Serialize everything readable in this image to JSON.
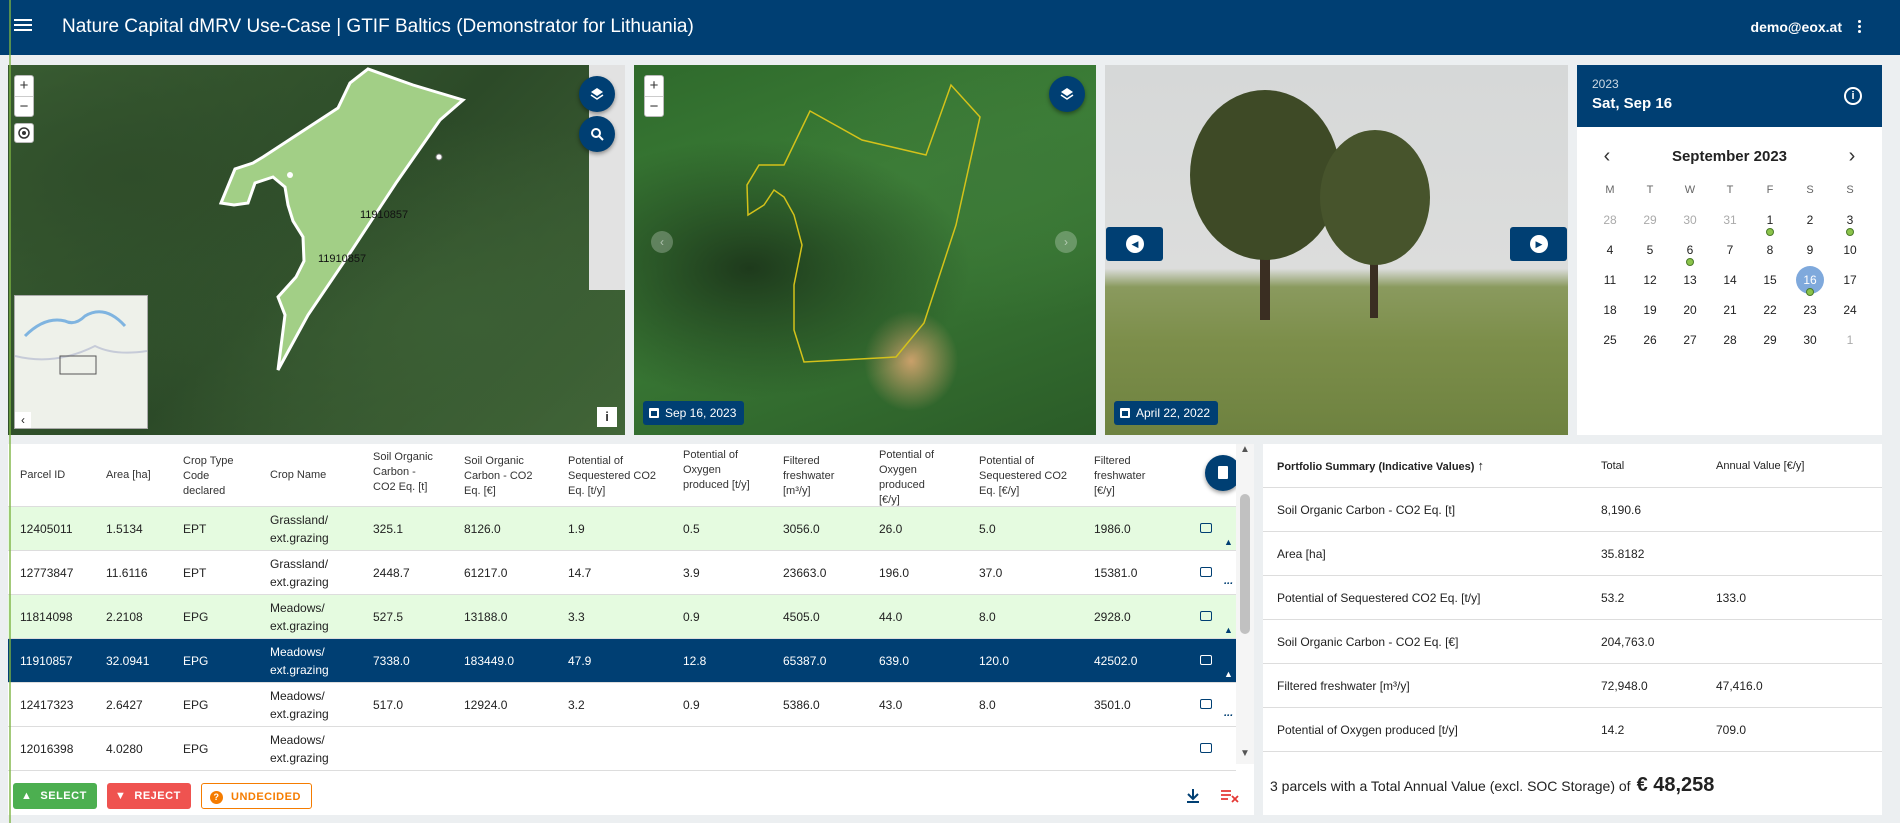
{
  "app": {
    "title": "Nature Capital dMRV Use-Case | GTIF Baltics (Demonstrator for Lithuania)",
    "user": "demo@eox.at"
  },
  "colors": {
    "primary": "#003f73",
    "accent_green": "#4caf50",
    "accent_red": "#ef5350",
    "accent_orange": "#f57c00",
    "row_green": "#e5fbe0"
  },
  "icons": [
    "menu-icon",
    "more-vert-icon",
    "layers-icon",
    "search-icon",
    "locate-icon",
    "calendar-icon",
    "info-icon",
    "chevron-left-icon",
    "chevron-right-icon",
    "comment-icon",
    "thumb-up-icon",
    "thumb-down-icon",
    "download-icon",
    "clear-list-icon",
    "document-icon"
  ],
  "map1": {
    "zoom_in": "+",
    "zoom_out": "−",
    "parcel_labels": [
      "11910857",
      "11910857"
    ],
    "collapse": "‹",
    "info": "i"
  },
  "map2": {
    "zoom_in": "+",
    "zoom_out": "−",
    "date": "Sep 16, 2023"
  },
  "photo": {
    "date": "April 22, 2022"
  },
  "calendar": {
    "year": "2023",
    "selected_day": "Sat, Sep 16",
    "month_label": "September 2023",
    "weekdays": [
      "M",
      "T",
      "W",
      "T",
      "F",
      "S",
      "S"
    ],
    "weeks": [
      [
        "28",
        "29",
        "30",
        "31",
        "1",
        "2",
        "3"
      ],
      [
        "4",
        "5",
        "6",
        "7",
        "8",
        "9",
        "10"
      ],
      [
        "11",
        "12",
        "13",
        "14",
        "15",
        "16",
        "17"
      ],
      [
        "18",
        "19",
        "20",
        "21",
        "22",
        "23",
        "24"
      ],
      [
        "25",
        "26",
        "27",
        "28",
        "29",
        "30",
        "1"
      ]
    ]
  },
  "table": {
    "headers": [
      "Parcel ID",
      "Area [ha]",
      "Crop Type Code declared",
      "Crop Name",
      "Soil Organic Carbon - CO2 Eq. [t]",
      "Soil Organic Carbon - CO2 Eq. [€]",
      "Potential of Sequestered CO2 Eq. [t/y]",
      "Potential of Oxygen produced [t/y]",
      "Filtered freshwater [m³/y]",
      "Potential of Oxygen produced [€/y]",
      "Potential of Sequestered CO2 Eq. [€/y]",
      "Filtered freshwater [€/y]"
    ],
    "rows": [
      {
        "id": "12405011",
        "area": "1.5134",
        "code": "EPT",
        "crop1": "Grassland/",
        "crop2": "ext.grazing",
        "soc_t": "325.1",
        "soc_eur": "8126.0",
        "seq_t": "1.9",
        "oxy_t": "0.5",
        "water_m3": "3056.0",
        "oxy_eur": "26.0",
        "seq_eur": "5.0",
        "water_eur": "1986.0",
        "status": "selected"
      },
      {
        "id": "12773847",
        "area": "11.6116",
        "code": "EPT",
        "crop1": "Grassland/",
        "crop2": "ext.grazing",
        "soc_t": "2448.7",
        "soc_eur": "61217.0",
        "seq_t": "14.7",
        "oxy_t": "3.9",
        "water_m3": "23663.0",
        "oxy_eur": "196.0",
        "seq_eur": "37.0",
        "water_eur": "15381.0",
        "status": "undecided"
      },
      {
        "id": "11814098",
        "area": "2.2108",
        "code": "EPG",
        "crop1": "Meadows/",
        "crop2": "ext.grazing",
        "soc_t": "527.5",
        "soc_eur": "13188.0",
        "seq_t": "3.3",
        "oxy_t": "0.9",
        "water_m3": "4505.0",
        "oxy_eur": "44.0",
        "seq_eur": "8.0",
        "water_eur": "2928.0",
        "status": "selected"
      },
      {
        "id": "11910857",
        "area": "32.0941",
        "code": "EPG",
        "crop1": "Meadows/",
        "crop2": "ext.grazing",
        "soc_t": "7338.0",
        "soc_eur": "183449.0",
        "seq_t": "47.9",
        "oxy_t": "12.8",
        "water_m3": "65387.0",
        "oxy_eur": "639.0",
        "seq_eur": "120.0",
        "water_eur": "42502.0",
        "status": "selected"
      },
      {
        "id": "12417323",
        "area": "2.6427",
        "code": "EPG",
        "crop1": "Meadows/",
        "crop2": "ext.grazing",
        "soc_t": "517.0",
        "soc_eur": "12924.0",
        "seq_t": "3.2",
        "oxy_t": "0.9",
        "water_m3": "5386.0",
        "oxy_eur": "43.0",
        "seq_eur": "8.0",
        "water_eur": "3501.0",
        "status": "undecided"
      },
      {
        "id": "12016398",
        "area": "4.0280",
        "code": "EPG",
        "crop1": "Meadows/",
        "crop2": "ext.grazing",
        "soc_t": "",
        "soc_eur": "",
        "seq_t": "",
        "oxy_t": "",
        "water_m3": "",
        "oxy_eur": "",
        "seq_eur": "",
        "water_eur": "",
        "status": "undecided"
      }
    ],
    "selected_row": 3
  },
  "actions": {
    "select": "SELECT",
    "reject": "REJECT",
    "undecided": "UNDECIDED"
  },
  "summary": {
    "header": "Portfolio Summary (Indicative Values)",
    "sort_arrow": "↑",
    "col_total": "Total",
    "col_annual": "Annual Value [€/y]",
    "rows": [
      {
        "label": "Soil Organic Carbon - CO2 Eq. [t]",
        "total": "8,190.6",
        "annual": ""
      },
      {
        "label": "Area [ha]",
        "total": "35.8182",
        "annual": ""
      },
      {
        "label": "Potential of Sequestered CO2 Eq. [t/y]",
        "total": "53.2",
        "annual": "133.0"
      },
      {
        "label": "Soil Organic Carbon - CO2 Eq. [€]",
        "total": "204,763.0",
        "annual": ""
      },
      {
        "label": "Filtered freshwater [m³/y]",
        "total": "72,948.0",
        "annual": "47,416.0"
      },
      {
        "label": "Potential of Oxygen produced [t/y]",
        "total": "14.2",
        "annual": "709.0"
      }
    ],
    "footer_text": "3 parcels with a Total Annual Value (excl. SOC Storage) of",
    "footer_value": "€ 48,258"
  }
}
